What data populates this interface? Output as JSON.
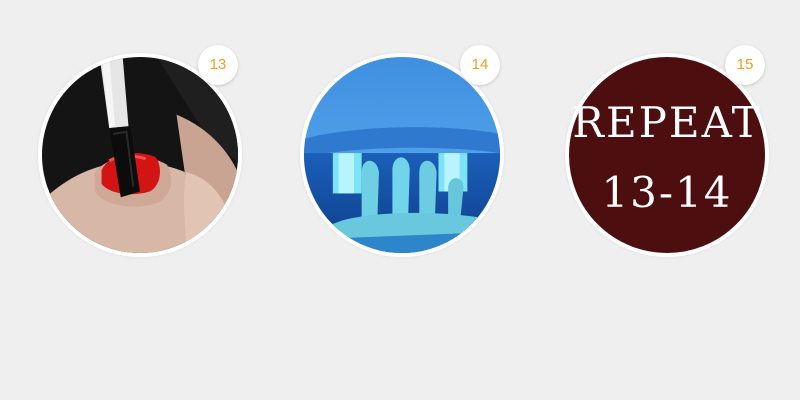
{
  "steps": [
    {
      "number": "13",
      "image": "brush applying gel polish to a red nail"
    },
    {
      "number": "14",
      "image": "hand under a blue UV nail lamp"
    },
    {
      "number": "15",
      "title": "REPEAT",
      "range": "13-14"
    }
  ],
  "colors": {
    "background": "#efefef",
    "badge_text": "#f2a11d",
    "repeat_circle": "#4c0e0f"
  }
}
